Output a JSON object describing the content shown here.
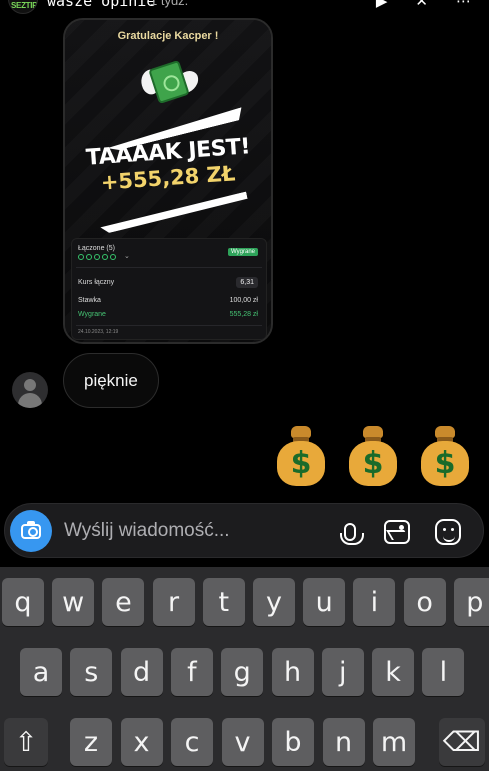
{
  "topbar": {
    "avatar_text": "SEZTIP",
    "username": "wasze opinie",
    "time": "1 tydz.",
    "icons": [
      "play-icon",
      "mute-icon",
      "more-icon"
    ]
  },
  "story": {
    "title": "Gratulacje Kacper !",
    "headline": "TAAAAK JEST!",
    "amount": "+555,28 ZŁ",
    "bet": {
      "name": "Łączone (5)",
      "status": "Wygrane",
      "odds_label": "Kurs łączny",
      "odds_value": "6,31",
      "stake_label": "Stawka",
      "stake_value": "100,00 zł",
      "win_label": "Wygrane",
      "win_value": "555,28 zł",
      "date": "24.10.2023, 12:19"
    }
  },
  "message": {
    "text": "pięknie"
  },
  "reaction": {
    "emojis": [
      "money-bag-icon",
      "money-bag-icon",
      "money-bag-icon"
    ]
  },
  "composer": {
    "placeholder": "Wyślij wiadomość..."
  },
  "keyboard": {
    "row1": [
      "q",
      "w",
      "e",
      "r",
      "t",
      "y",
      "u",
      "i",
      "o",
      "p"
    ],
    "row2": [
      "a",
      "s",
      "d",
      "f",
      "g",
      "h",
      "j",
      "k",
      "l"
    ],
    "row3": [
      "z",
      "x",
      "c",
      "v",
      "b",
      "n",
      "m"
    ]
  },
  "colors": {
    "accent": "#3797f0",
    "win": "#46c474",
    "gold": "#f2d36b"
  }
}
